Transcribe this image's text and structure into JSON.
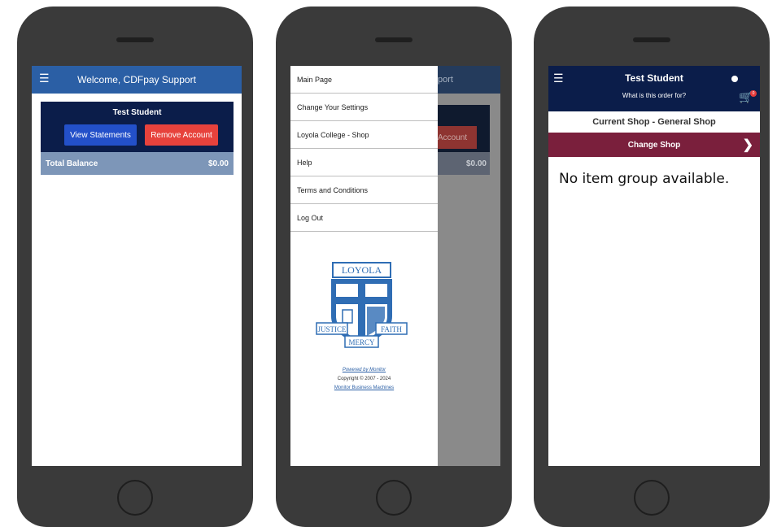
{
  "phone1": {
    "header_title": "Welcome, CDFpay Support",
    "menu_icon": "hamburger-icon",
    "student_name": "Test Student",
    "view_statements": "View Statements",
    "remove_account": "Remove Account",
    "total_label": "Total Balance",
    "total_value": "$0.00"
  },
  "phone2": {
    "menu_items": [
      {
        "label": "Main Page"
      },
      {
        "label": "Change Your Settings"
      },
      {
        "label": "Loyola College - Shop"
      },
      {
        "label": "Help"
      },
      {
        "label": "Terms and Conditions"
      },
      {
        "label": "Log Out"
      }
    ],
    "bg_header": "port",
    "bg_button": "Account",
    "bg_balance": "$0.00",
    "logo": {
      "title": "LOYOLA",
      "left": "JUSTICE",
      "right": "FAITH",
      "bottom": "MERCY"
    },
    "powered_by": "Powered by Monitor",
    "copyright": "Copyright © 2007 - 2024",
    "company": "Monitor Business Machines"
  },
  "phone3": {
    "title": "Test Student",
    "subtitle": "What is this order for?",
    "cart_badge": "0",
    "current_shop": "Current Shop - General Shop",
    "change_shop": "Change Shop",
    "empty_message": "No item group available."
  }
}
